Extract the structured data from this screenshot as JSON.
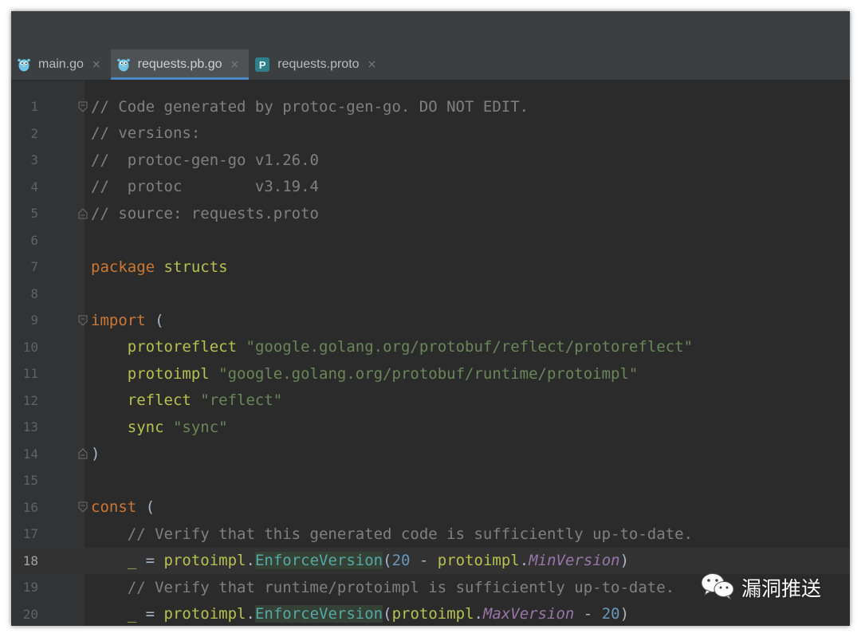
{
  "tabs": [
    {
      "label": "main.go",
      "icon": "gopher-icon",
      "active": false
    },
    {
      "label": "requests.pb.go",
      "icon": "gopher-icon",
      "active": true
    },
    {
      "label": "requests.proto",
      "icon": "proto-file-icon",
      "badge": "P",
      "active": false
    }
  ],
  "tab_close_glyph": "×",
  "current_line": 18,
  "code_lines": [
    {
      "n": "1",
      "fold": "open",
      "tokens": [
        {
          "t": "// Code generated by protoc-gen-go. DO NOT EDIT.",
          "c": "comment"
        }
      ]
    },
    {
      "n": "2",
      "tokens": [
        {
          "t": "// versions:",
          "c": "comment"
        }
      ]
    },
    {
      "n": "3",
      "tokens": [
        {
          "t": "//  protoc-gen-go v1.26.0",
          "c": "comment"
        }
      ]
    },
    {
      "n": "4",
      "tokens": [
        {
          "t": "//  protoc        v3.19.4",
          "c": "comment"
        }
      ]
    },
    {
      "n": "5",
      "fold": "close",
      "tokens": [
        {
          "t": "// source: requests.proto",
          "c": "comment"
        }
      ]
    },
    {
      "n": "6",
      "tokens": []
    },
    {
      "n": "7",
      "tokens": [
        {
          "t": "package",
          "c": "kw"
        },
        {
          "t": " "
        },
        {
          "t": "structs",
          "c": "pkg"
        }
      ]
    },
    {
      "n": "8",
      "tokens": []
    },
    {
      "n": "9",
      "fold": "open",
      "tokens": [
        {
          "t": "import",
          "c": "kw"
        },
        {
          "t": " ("
        }
      ]
    },
    {
      "n": "10",
      "tokens": [
        {
          "t": "    "
        },
        {
          "t": "protoreflect",
          "c": "pkg"
        },
        {
          "t": " "
        },
        {
          "t": "\"google.golang.org/protobuf/reflect/protoreflect\"",
          "c": "str"
        }
      ]
    },
    {
      "n": "11",
      "tokens": [
        {
          "t": "    "
        },
        {
          "t": "protoimpl",
          "c": "pkg"
        },
        {
          "t": " "
        },
        {
          "t": "\"google.golang.org/protobuf/runtime/protoimpl\"",
          "c": "str"
        }
      ]
    },
    {
      "n": "12",
      "tokens": [
        {
          "t": "    "
        },
        {
          "t": "reflect",
          "c": "pkg"
        },
        {
          "t": " "
        },
        {
          "t": "\"reflect\"",
          "c": "str"
        }
      ]
    },
    {
      "n": "13",
      "tokens": [
        {
          "t": "    "
        },
        {
          "t": "sync",
          "c": "pkg"
        },
        {
          "t": " "
        },
        {
          "t": "\"sync\"",
          "c": "str"
        }
      ]
    },
    {
      "n": "14",
      "fold": "close",
      "tokens": [
        {
          "t": ")"
        }
      ]
    },
    {
      "n": "15",
      "tokens": []
    },
    {
      "n": "16",
      "fold": "open",
      "tokens": [
        {
          "t": "const",
          "c": "kw"
        },
        {
          "t": " ("
        }
      ]
    },
    {
      "n": "17",
      "tokens": [
        {
          "t": "    "
        },
        {
          "t": "// Verify that this generated code is sufficiently up-to-date.",
          "c": "comment"
        }
      ]
    },
    {
      "n": "18",
      "tokens": [
        {
          "t": "    "
        },
        {
          "t": "_",
          "c": "under"
        },
        {
          "t": " = "
        },
        {
          "t": "protoimpl",
          "c": "pkg"
        },
        {
          "t": "."
        },
        {
          "t": "EnforceVersion",
          "c": "fn",
          "hl": true
        },
        {
          "t": "("
        },
        {
          "t": "20",
          "c": "num"
        },
        {
          "t": " - "
        },
        {
          "t": "protoimpl",
          "c": "pkg"
        },
        {
          "t": "."
        },
        {
          "t": "MinVersion",
          "c": "italic"
        },
        {
          "t": ")"
        }
      ]
    },
    {
      "n": "19",
      "tokens": [
        {
          "t": "    "
        },
        {
          "t": "// Verify that runtime/protoimpl is sufficiently up-to-date.",
          "c": "comment"
        }
      ]
    },
    {
      "n": "20",
      "tokens": [
        {
          "t": "    "
        },
        {
          "t": "_",
          "c": "under"
        },
        {
          "t": " = "
        },
        {
          "t": "protoimpl",
          "c": "pkg"
        },
        {
          "t": "."
        },
        {
          "t": "EnforceVersion",
          "c": "fn",
          "hl": true
        },
        {
          "t": "("
        },
        {
          "t": "protoimpl",
          "c": "pkg"
        },
        {
          "t": "."
        },
        {
          "t": "MaxVersion",
          "c": "italic"
        },
        {
          "t": " - "
        },
        {
          "t": "20",
          "c": "num"
        },
        {
          "t": ")"
        }
      ]
    }
  ],
  "watermark": {
    "text": "漏洞推送",
    "icon": "wechat-icon"
  },
  "colors": {
    "background": "#2b2b2b",
    "gutter": "#313335",
    "tab_active_underline": "#4a88c7",
    "keyword": "#cc7832",
    "comment": "#808080",
    "string": "#6a8759",
    "package": "#b5c24f",
    "function": "#57a8a8",
    "number": "#6897bb",
    "constant": "#9876aa"
  }
}
